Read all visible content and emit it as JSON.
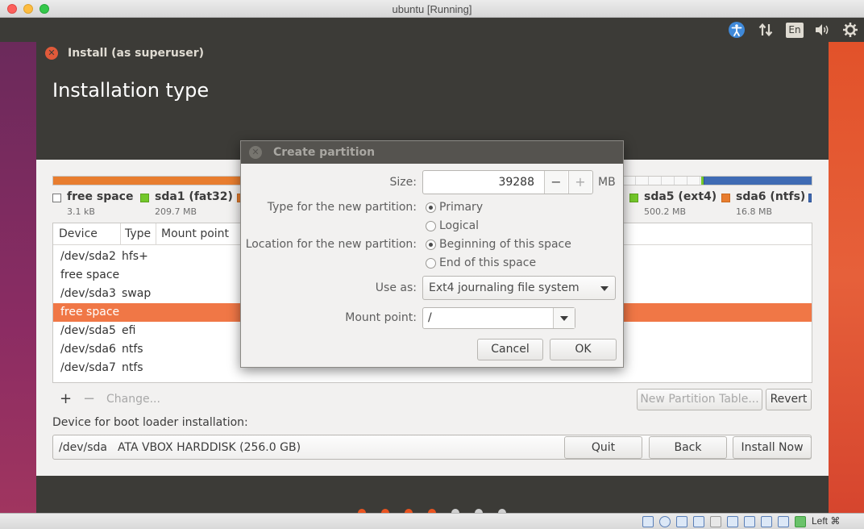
{
  "host": {
    "title": "ubuntu [Running]",
    "host_key": "Left ⌘"
  },
  "panel": {
    "keyboard": "En"
  },
  "window": {
    "title": "Install (as superuser)",
    "heading": "Installation type"
  },
  "legend": [
    {
      "name": "free space",
      "size": "3.1 kB",
      "color": "#ffffff"
    },
    {
      "name": "sda1 (fat32)",
      "size": "209.7 MB",
      "color": "#73c82a"
    },
    {
      "name": "sda5 (ext4)",
      "size": "500.2 MB",
      "color": "#73c82a"
    },
    {
      "name": "sda6 (ntfs)",
      "size": "16.8 MB",
      "color": "#e87d2f"
    }
  ],
  "table": {
    "headers": {
      "device": "Device",
      "type": "Type",
      "mount": "Mount point"
    },
    "rows": [
      {
        "device": "/dev/sda2",
        "type": "hfs+"
      },
      {
        "device": "free space",
        "type": ""
      },
      {
        "device": "/dev/sda3",
        "type": "swap"
      },
      {
        "device": "free space",
        "type": "",
        "selected": true
      },
      {
        "device": "/dev/sda5",
        "type": "efi"
      },
      {
        "device": "/dev/sda6",
        "type": "ntfs"
      },
      {
        "device": "/dev/sda7",
        "type": "ntfs"
      }
    ]
  },
  "toolbar": {
    "add": "+",
    "remove": "−",
    "change": "Change...",
    "new_table": "New Partition Table...",
    "revert": "Revert"
  },
  "boot": {
    "label": "Device for boot loader installation:",
    "device": "/dev/sda",
    "description": "ATA VBOX HARDDISK (256.0 GB)"
  },
  "buttons": {
    "quit": "Quit",
    "back": "Back",
    "install": "Install Now"
  },
  "progress": {
    "total_steps": 7,
    "completed_steps": 4
  },
  "dialog": {
    "title": "Create partition",
    "size_label": "Size:",
    "size_value": "39288",
    "size_unit": "MB",
    "minus": "−",
    "plus": "+",
    "type_label": "Type for the new partition:",
    "type_options": [
      "Primary",
      "Logical"
    ],
    "type_selected": "Primary",
    "location_label": "Location for the new partition:",
    "location_options": [
      "Beginning of this space",
      "End of this space"
    ],
    "location_selected": "Beginning of this space",
    "use_as_label": "Use as:",
    "use_as_value": "Ext4 journaling file system",
    "mount_label": "Mount point:",
    "mount_value": "/",
    "cancel": "Cancel",
    "ok": "OK"
  }
}
